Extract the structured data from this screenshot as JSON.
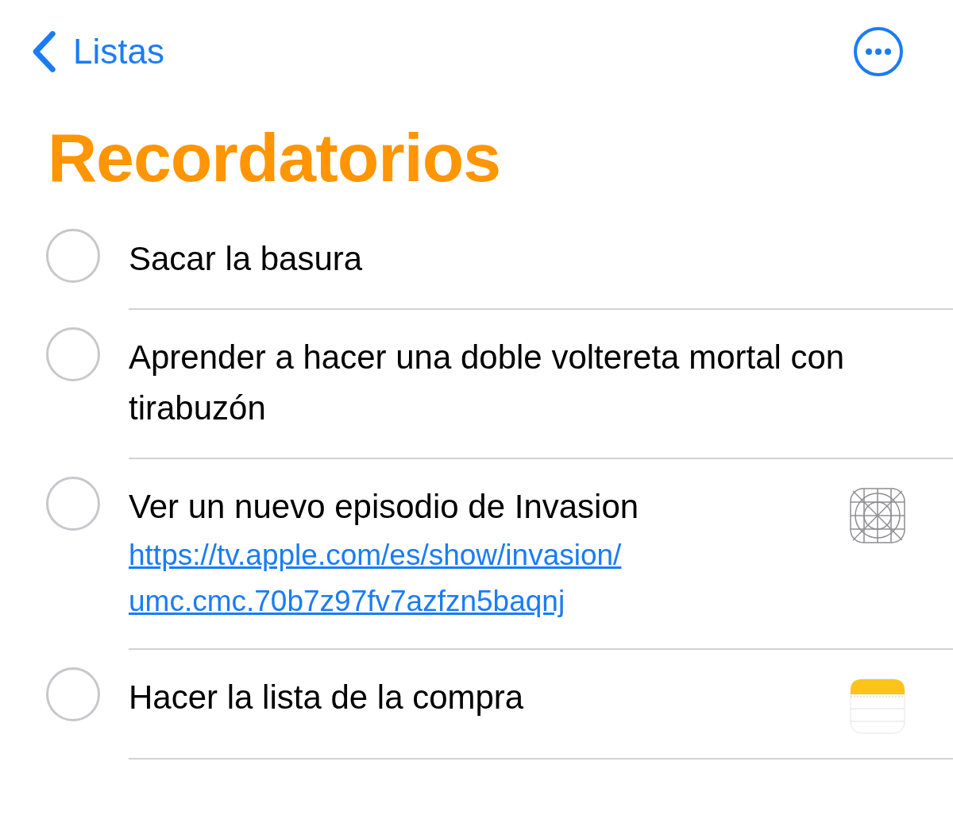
{
  "nav": {
    "back_label": "Listas"
  },
  "title": "Recordatorios",
  "reminders": [
    {
      "text": "Sacar la basura",
      "completed": false
    },
    {
      "text": "Aprender a hacer una doble voltereta mortal con tirabuzón",
      "completed": false
    },
    {
      "text": "Ver un nuevo episodio de Invasion",
      "completed": false,
      "link_lines": [
        "https://tv.apple.com/es/show/invasion/",
        "umc.cmc.70b7z97fv7azfzn5baqnj"
      ],
      "attachment": {
        "kind": "app"
      }
    },
    {
      "text": "Hacer la lista de la compra",
      "completed": false,
      "attachment": {
        "kind": "notes"
      }
    }
  ]
}
